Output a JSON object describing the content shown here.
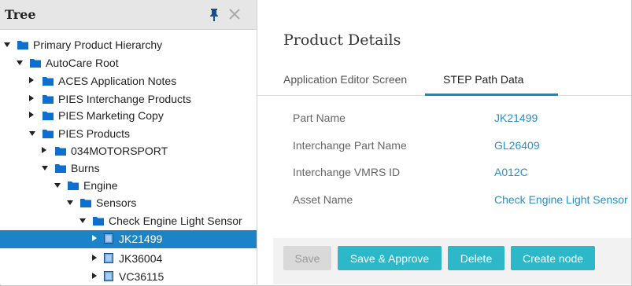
{
  "tree": {
    "title": "Tree",
    "items": [
      {
        "label": "Primary Product Hierarchy",
        "arrow": "down",
        "icon": "folder-icon"
      },
      {
        "label": "AutoCare Root",
        "arrow": "down",
        "icon": "folder-icon"
      },
      {
        "label": "ACES Application Notes",
        "arrow": "right",
        "icon": "folder-icon"
      },
      {
        "label": "PIES Interchange Products",
        "arrow": "right",
        "icon": "folder-icon"
      },
      {
        "label": "PIES Marketing Copy",
        "arrow": "right",
        "icon": "folder-icon"
      },
      {
        "label": "PIES Products",
        "arrow": "down",
        "icon": "folder-icon"
      },
      {
        "label": "034MOTORSPORT",
        "arrow": "right",
        "icon": "folder-icon"
      },
      {
        "label": "Burns",
        "arrow": "down",
        "icon": "folder-icon"
      },
      {
        "label": "Engine",
        "arrow": "down",
        "icon": "folder-icon"
      },
      {
        "label": "Sensors",
        "arrow": "down",
        "icon": "folder-icon"
      },
      {
        "label": "Check Engine Light Sensor",
        "arrow": "down",
        "icon": "folder-icon"
      },
      {
        "label": "JK21499",
        "arrow": "right",
        "icon": "product-icon",
        "selected": true
      },
      {
        "label": "JK36004",
        "arrow": "right",
        "icon": "product-icon"
      },
      {
        "label": "VC36115",
        "arrow": "right",
        "icon": "product-icon"
      }
    ]
  },
  "details": {
    "title": "Product Details",
    "tabs": [
      {
        "label": "Application Editor Screen",
        "active": false
      },
      {
        "label": "STEP Path Data",
        "active": true
      }
    ],
    "fields": [
      {
        "label": "Part Name",
        "value": "JK21499"
      },
      {
        "label": "Interchange Part Name",
        "value": "GL26409"
      },
      {
        "label": "Interchange VMRS ID",
        "value": "A012C"
      },
      {
        "label": "Asset Name",
        "value": "Check Engine Light Sensor"
      }
    ],
    "buttons": {
      "save": "Save",
      "save_approve": "Save & Approve",
      "delete": "Delete",
      "create_node": "Create node"
    }
  },
  "colors": {
    "accent": "#1c84c6",
    "link": "#2a8fc7",
    "button": "#2db8c9",
    "folder": "#0d6fd0",
    "selected_row": "#1c84c6"
  }
}
